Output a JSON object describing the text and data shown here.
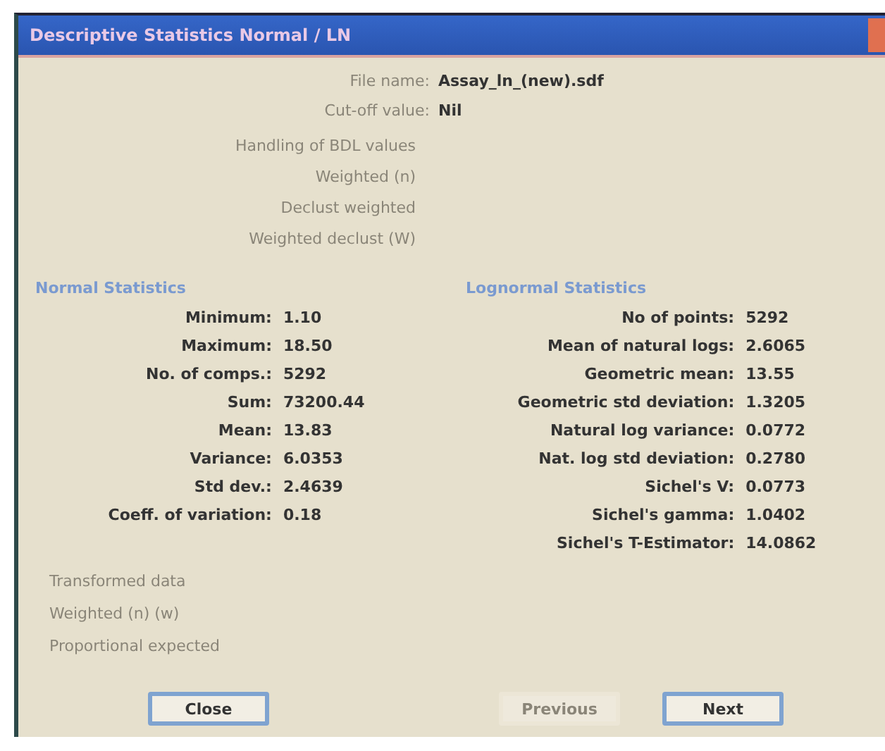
{
  "window": {
    "title": "Descriptive Statistics Normal / LN"
  },
  "header_fields": [
    {
      "label": "File name:",
      "value": "Assay_ln_(new).sdf"
    },
    {
      "label": "Cut-off value:",
      "value": "Nil"
    }
  ],
  "options": [
    {
      "label": "Handling of BDL values",
      "disabled": true
    },
    {
      "label": "Weighted (n)",
      "disabled": true
    },
    {
      "label": "Declust weighted",
      "disabled": true
    },
    {
      "label": "Weighted declust (W)",
      "disabled": true
    }
  ],
  "normal_statistics": {
    "title": "Normal Statistics",
    "rows": [
      {
        "label": "Minimum:",
        "value": "1.10"
      },
      {
        "label": "Maximum:",
        "value": "18.50"
      },
      {
        "label": "No. of comps.:",
        "value": "5292"
      },
      {
        "label": "Sum:",
        "value": "73200.44"
      },
      {
        "label": "Mean:",
        "value": "13.83"
      },
      {
        "label": "Variance:",
        "value": "6.0353"
      },
      {
        "label": "Std dev.:",
        "value": "2.4639"
      },
      {
        "label": "Coeff. of variation:",
        "value": "0.18"
      }
    ]
  },
  "lognormal_statistics": {
    "title": "Lognormal Statistics",
    "rows": [
      {
        "label": "No of points:",
        "value": "5292"
      },
      {
        "label": "Mean of natural logs:",
        "value": "2.6065"
      },
      {
        "label": "Geometric mean:",
        "value": "13.55"
      },
      {
        "label": "Geometric std deviation:",
        "value": "1.3205"
      },
      {
        "label": "Natural log variance:",
        "value": "0.0772"
      },
      {
        "label": "Nat. log std deviation:",
        "value": "0.2780"
      },
      {
        "label": "Sichel's V:",
        "value": "0.0773"
      },
      {
        "label": "Sichel's gamma:",
        "value": "1.0402"
      },
      {
        "label": "Sichel's T-Estimator:",
        "value": "14.0862"
      }
    ]
  },
  "footer_options": [
    {
      "label": "Transformed data",
      "disabled": true
    },
    {
      "label": "Weighted (n) (w)",
      "disabled": true
    },
    {
      "label": "Proportional expected",
      "disabled": true
    }
  ],
  "buttons": [
    {
      "label": "Close",
      "disabled": false
    },
    {
      "label": "Previous",
      "disabled": true
    },
    {
      "label": "Next",
      "disabled": false
    }
  ]
}
